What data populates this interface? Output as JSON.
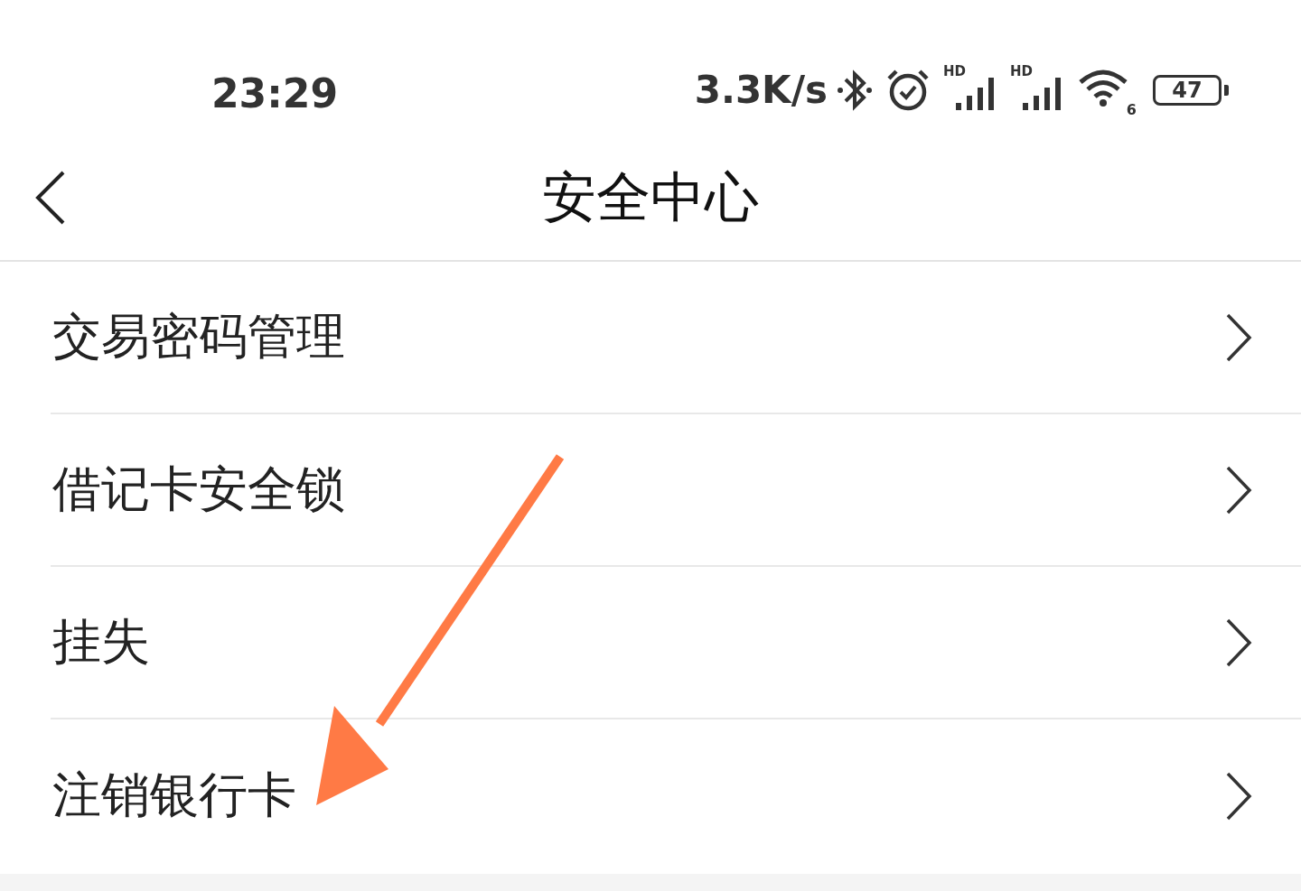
{
  "status_bar": {
    "time": "23:29",
    "speed": "3.3K/s",
    "signals": [
      {
        "badge": "HD"
      },
      {
        "badge": "HD"
      }
    ],
    "wifi_badge": "6",
    "battery": "47"
  },
  "header": {
    "title": "安全中心"
  },
  "menu": [
    {
      "label": "交易密码管理"
    },
    {
      "label": "借记卡安全锁"
    },
    {
      "label": "挂失"
    },
    {
      "label": "注销银行卡"
    }
  ]
}
